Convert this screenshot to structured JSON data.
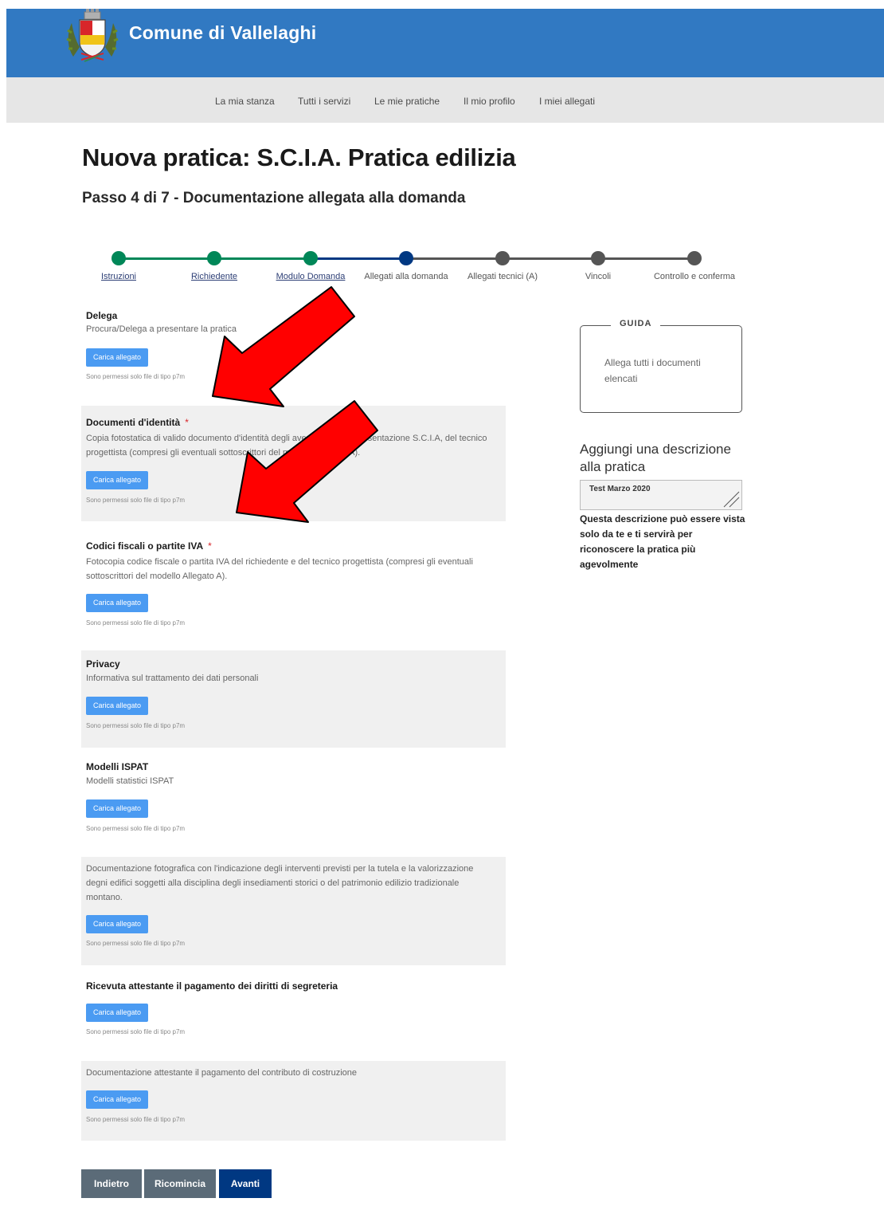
{
  "header": {
    "site_name": "Comune di Vallelaghi"
  },
  "nav": {
    "items": [
      "La mia stanza",
      "Tutti i servizi",
      "Le mie pratiche",
      "Il mio profilo",
      "I miei allegati"
    ]
  },
  "page": {
    "title": "Nuova pratica: S.C.I.A. Pratica edilizia",
    "subtitle": "Passo 4 di 7 - Documentazione allegata alla domanda"
  },
  "steps": [
    {
      "label": "Istruzioni",
      "state": "done"
    },
    {
      "label": "Richiedente",
      "state": "done"
    },
    {
      "label": "Modulo Domanda",
      "state": "done"
    },
    {
      "label": "Allegati alla domanda",
      "state": "current"
    },
    {
      "label": "Allegati tecnici (A)",
      "state": "todo"
    },
    {
      "label": "Vincoli",
      "state": "todo"
    },
    {
      "label": "Controllo e conferma",
      "state": "todo"
    }
  ],
  "colors": {
    "done": "#008758",
    "current": "#003882",
    "todo": "#555555",
    "header": "#3179c2",
    "upload_button": "#4b9bf2",
    "required_star": "#d8262a"
  },
  "attachments": [
    {
      "title": "Delega",
      "required": false,
      "description": "Procura/Delega a presentare la pratica"
    },
    {
      "title": "Documenti d'identità",
      "required": true,
      "description": "Copia fotostatica di valido documento d'identità degli aventi titolo alla presentazione S.C.I.A, del tecnico progettista (compresi gli eventuali sottoscrittori del modello Allegato A)."
    },
    {
      "title": "Codici fiscali o partite IVA",
      "required": true,
      "description": "Fotocopia codice fiscale o partita IVA del richiedente e del tecnico progettista (compresi gli eventuali sottoscrittori del modello Allegato A)."
    },
    {
      "title": "Privacy",
      "required": false,
      "description": "Informativa sul trattamento dei dati personali"
    },
    {
      "title": "Modelli ISPAT",
      "required": false,
      "description": "Modelli statistici ISPAT"
    },
    {
      "title": "",
      "required": false,
      "description": "Documentazione fotografica con l'indicazione degli interventi previsti per la tutela e la valorizzazione degni edifici soggetti alla disciplina degli insediamenti storici o del patrimonio edilizio tradizionale montano."
    },
    {
      "title": "Ricevuta attestante il pagamento dei diritti di segreteria",
      "required": false,
      "description": ""
    },
    {
      "title": "",
      "required": false,
      "description": "Documentazione attestante il pagamento del contributo di costruzione"
    }
  ],
  "upload": {
    "button_label": "Carica allegato",
    "hint": "Sono permessi solo file di tipo p7m",
    "required_marker": "*"
  },
  "guide": {
    "title": "GUIDA",
    "text": "Allega tutti i documenti elencati"
  },
  "description_box": {
    "heading": "Aggiungi una descrizione alla pratica",
    "value": "Test Marzo 2020",
    "note": "Questa descrizione può essere vista solo da te e ti servirà per riconoscere la pratica più agevolmente"
  },
  "buttons": {
    "back": "Indietro",
    "restart": "Ricomincia",
    "next": "Avanti"
  },
  "annotations": {
    "arrow_color": "#ff0000"
  }
}
